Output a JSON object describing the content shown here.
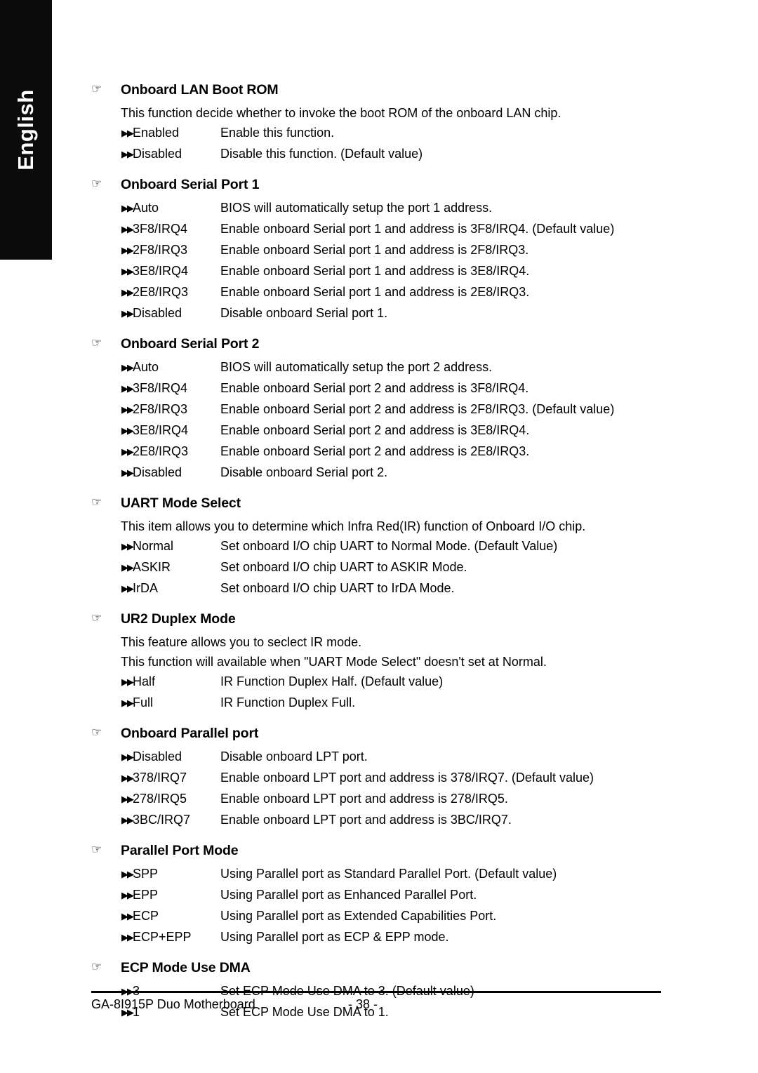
{
  "side_tab": {
    "label": "English"
  },
  "icons": {
    "heading_bullet": "☞",
    "option_bullet": "▶▶"
  },
  "sections": [
    {
      "title": "Onboard LAN Boot ROM",
      "paragraphs": [
        "This function decide whether to invoke the boot ROM of the onboard LAN chip."
      ],
      "options": [
        {
          "label": "Enabled",
          "desc": "Enable this function."
        },
        {
          "label": "Disabled",
          "desc": "Disable this function. (Default value)"
        }
      ]
    },
    {
      "title": "Onboard Serial Port 1",
      "paragraphs": [],
      "options": [
        {
          "label": "Auto",
          "desc": "BIOS will automatically setup the port 1 address."
        },
        {
          "label": "3F8/IRQ4",
          "desc": "Enable onboard Serial port 1 and address is 3F8/IRQ4. (Default value)"
        },
        {
          "label": "2F8/IRQ3",
          "desc": "Enable onboard Serial port 1 and address is 2F8/IRQ3."
        },
        {
          "label": "3E8/IRQ4",
          "desc": "Enable onboard Serial port 1 and address is 3E8/IRQ4."
        },
        {
          "label": "2E8/IRQ3",
          "desc": "Enable onboard Serial port 1 and address is 2E8/IRQ3."
        },
        {
          "label": "Disabled",
          "desc": "Disable onboard Serial port 1."
        }
      ]
    },
    {
      "title": "Onboard Serial Port 2",
      "paragraphs": [],
      "options": [
        {
          "label": "Auto",
          "desc": "BIOS will automatically setup the port 2 address."
        },
        {
          "label": "3F8/IRQ4",
          "desc": "Enable onboard Serial port 2 and address is 3F8/IRQ4."
        },
        {
          "label": "2F8/IRQ3",
          "desc": "Enable onboard Serial port 2 and address is 2F8/IRQ3. (Default value)"
        },
        {
          "label": "3E8/IRQ4",
          "desc": "Enable onboard Serial port 2 and address is 3E8/IRQ4."
        },
        {
          "label": "2E8/IRQ3",
          "desc": "Enable onboard Serial port 2 and address is 2E8/IRQ3."
        },
        {
          "label": "Disabled",
          "desc": "Disable onboard Serial port 2."
        }
      ]
    },
    {
      "title": "UART Mode Select",
      "paragraphs": [
        "This item allows you to determine which Infra Red(IR) function of Onboard I/O chip."
      ],
      "options": [
        {
          "label": "Normal",
          "desc": "Set onboard I/O chip UART to Normal Mode. (Default Value)"
        },
        {
          "label": "ASKIR",
          "desc": "Set onboard I/O chip UART to ASKIR Mode."
        },
        {
          "label": "IrDA",
          "desc": "Set onboard I/O chip UART to IrDA Mode."
        }
      ]
    },
    {
      "title": "UR2 Duplex Mode",
      "paragraphs": [
        "This feature allows you to seclect IR mode.",
        "This function will available when \"UART Mode Select\" doesn't set at Normal."
      ],
      "options": [
        {
          "label": "Half",
          "desc": "IR Function Duplex Half. (Default value)"
        },
        {
          "label": "Full",
          "desc": "IR Function Duplex Full."
        }
      ]
    },
    {
      "title": "Onboard Parallel port",
      "paragraphs": [],
      "options": [
        {
          "label": "Disabled",
          "desc": "Disable onboard LPT port."
        },
        {
          "label": "378/IRQ7",
          "desc": "Enable onboard LPT port and address is 378/IRQ7. (Default value)"
        },
        {
          "label": "278/IRQ5",
          "desc": "Enable onboard LPT port and address is 278/IRQ5."
        },
        {
          "label": "3BC/IRQ7",
          "desc": "Enable onboard LPT port and address is 3BC/IRQ7."
        }
      ]
    },
    {
      "title": "Parallel Port Mode",
      "paragraphs": [],
      "options": [
        {
          "label": "SPP",
          "desc": "Using Parallel port as Standard Parallel Port. (Default value)"
        },
        {
          "label": "EPP",
          "desc": "Using Parallel port as Enhanced Parallel Port."
        },
        {
          "label": "ECP",
          "desc": "Using Parallel port as Extended Capabilities Port."
        },
        {
          "label": "ECP+EPP",
          "desc": "Using Parallel port as ECP & EPP mode."
        }
      ]
    },
    {
      "title": "ECP Mode Use DMA",
      "paragraphs": [],
      "options": [
        {
          "label": "3",
          "desc": "Set ECP Mode Use DMA to 3. (Default value)"
        },
        {
          "label": "1",
          "desc": "Set ECP Mode Use DMA to 1."
        }
      ]
    }
  ],
  "footer": {
    "product": "GA-8I915P Duo Motherboard",
    "page_number": "- 38 -"
  }
}
